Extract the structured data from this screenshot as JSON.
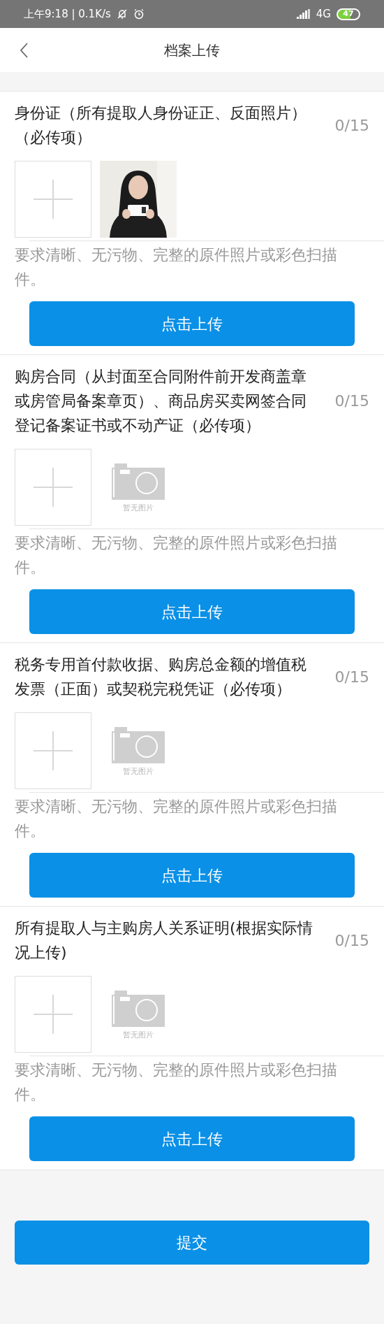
{
  "status_bar": {
    "time": "上午9:18 | 0.1K/s",
    "network": "4G",
    "battery": "47"
  },
  "nav": {
    "title": "档案上传"
  },
  "sections": [
    {
      "title": "身份证（所有提取人身份证正、反面照片）（必传项）",
      "count": "0/15",
      "hint": "要求清晰、无污物、完整的原件照片或彩色扫描件。",
      "button": "点击上传"
    },
    {
      "title": "购房合同（从封面至合同附件前开发商盖章或房管局备案章页）、商品房买卖网签合同登记备案证书或不动产证（必传项）",
      "count": "0/15",
      "preview": {
        "kind": "empty",
        "label": "暂无图片"
      },
      "hint": "要求清晰、无污物、完整的原件照片或彩色扫描件。",
      "button": "点击上传"
    },
    {
      "title": "税务专用首付款收据、购房总金额的增值税发票（正面）或契税完税凭证（必传项）",
      "count": "0/15",
      "preview": {
        "kind": "empty",
        "label": "暂无图片"
      },
      "hint": "要求清晰、无污物、完整的原件照片或彩色扫描件。",
      "button": "点击上传"
    },
    {
      "title": "所有提取人与主购房人关系证明(根据实际情况上传)",
      "count": "0/15",
      "preview": {
        "kind": "empty",
        "label": "暂无图片"
      },
      "hint": "要求清晰、无污物、完整的原件照片或彩色扫描件。",
      "button": "点击上传"
    }
  ],
  "submit": "提交"
}
